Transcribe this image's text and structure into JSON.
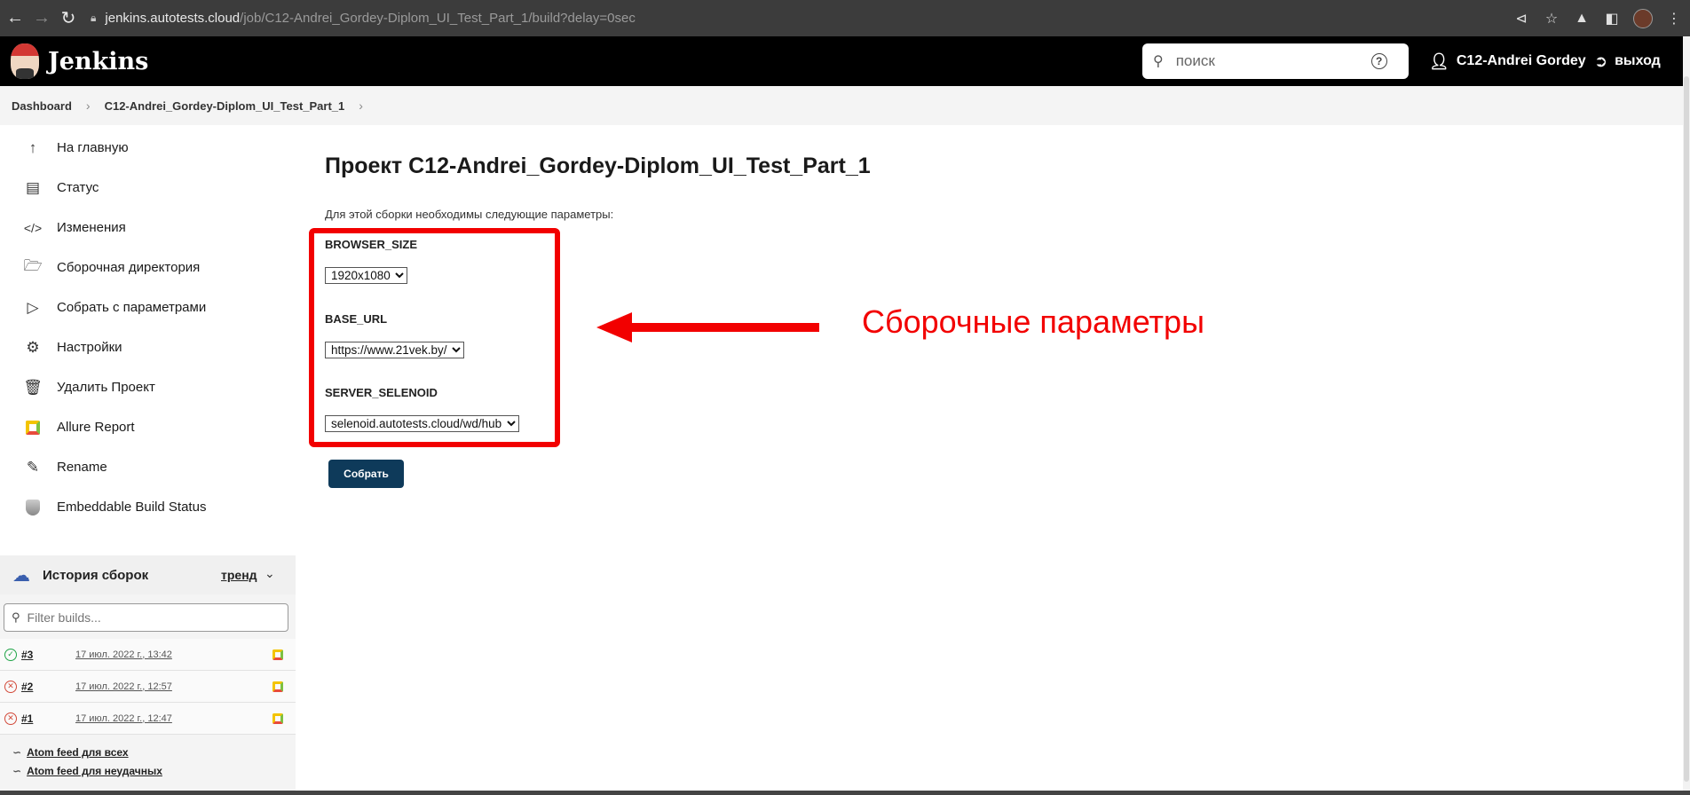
{
  "browser": {
    "url_host": "jenkins.autotests.cloud",
    "url_path": "/job/C12-Andrei_Gordey-Diplom_UI_Test_Part_1/build?delay=0sec"
  },
  "header": {
    "title": "Jenkins",
    "search_placeholder": "поиск",
    "help": "?",
    "user": "C12-Andrei Gordey",
    "logout": "выход"
  },
  "breadcrumb": {
    "items": [
      "Dashboard",
      "C12-Andrei_Gordey-Diplom_UI_Test_Part_1"
    ]
  },
  "sidebar": {
    "items": [
      {
        "label": "На главную",
        "icon": "arrow-up-icon"
      },
      {
        "label": "Статус",
        "icon": "document-icon"
      },
      {
        "label": "Изменения",
        "icon": "code-icon"
      },
      {
        "label": "Сборочная директория",
        "icon": "folder-icon"
      },
      {
        "label": "Собрать с параметрами",
        "icon": "play-icon"
      },
      {
        "label": "Настройки",
        "icon": "gear-icon"
      },
      {
        "label": "Удалить Проект",
        "icon": "trash-icon"
      },
      {
        "label": "Allure Report",
        "icon": "allure-icon"
      },
      {
        "label": "Rename",
        "icon": "pencil-icon"
      },
      {
        "label": "Embeddable Build Status",
        "icon": "shield-icon"
      }
    ]
  },
  "history": {
    "title": "История сборок",
    "trend": "тренд",
    "filter_placeholder": "Filter builds...",
    "builds": [
      {
        "number": "#3",
        "date": "17 июл. 2022 г., 13:42",
        "status": "success"
      },
      {
        "number": "#2",
        "date": "17 июл. 2022 г., 12:57",
        "status": "failed"
      },
      {
        "number": "#1",
        "date": "17 июл. 2022 г., 12:47",
        "status": "failed"
      }
    ],
    "feeds": [
      "Atom feed для всех",
      "Atom feed для неудачных"
    ]
  },
  "main": {
    "title": "Проект C12-Andrei_Gordey-Diplom_UI_Test_Part_1",
    "intro": "Для этой сборки необходимы следующие параметры:",
    "params": [
      {
        "name": "BROWSER_SIZE",
        "value": "1920x1080"
      },
      {
        "name": "BASE_URL",
        "value": "https://www.21vek.by/"
      },
      {
        "name": "SERVER_SELENOID",
        "value": "selenoid.autotests.cloud/wd/hub"
      }
    ],
    "build_button": "Собрать"
  },
  "annotation": {
    "text": "Сборочные параметры",
    "color": "#f20000"
  },
  "colors": {
    "header_bg": "#000000",
    "button_bg": "#0e3a5a",
    "success": "#1ea446",
    "failure": "#d24939"
  }
}
